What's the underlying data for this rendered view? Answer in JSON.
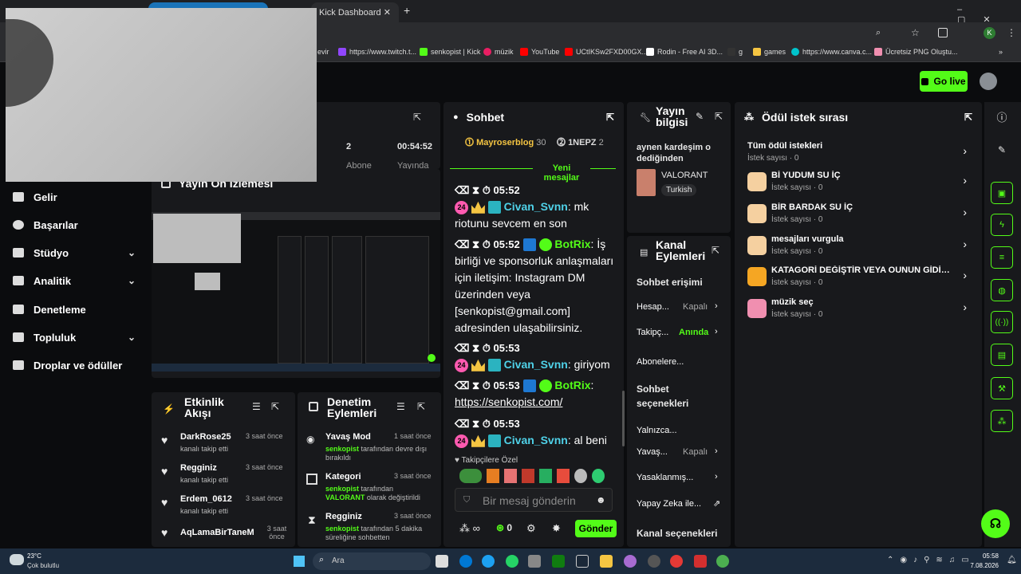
{
  "browser": {
    "tab_title": "Kick Dashboard",
    "new_tab": "+",
    "bookmarks": [
      "evir",
      "https://www.twitch.t...",
      "senkopist | Kick",
      "müzik",
      "YouTube",
      "UCtIKSw2FXD00GX...",
      "Rodin - Free AI 3D...",
      "g",
      "games",
      "https://www.canva.c...",
      "Ücretsiz PNG Oluştu..."
    ],
    "profile_initial": "K"
  },
  "header": {
    "go_live": "Go live"
  },
  "stats": {
    "subs_value": "2",
    "subs_label": "Abone",
    "time_value": "00:54:52",
    "time_label": "Yayında"
  },
  "sidebar": {
    "items": [
      {
        "label": "Gelir"
      },
      {
        "label": "Başarılar"
      },
      {
        "label": "Stüdyo",
        "chev": "⌄"
      },
      {
        "label": "Analitik",
        "chev": "⌄"
      },
      {
        "label": "Denetleme"
      },
      {
        "label": "Topluluk",
        "chev": "⌄"
      },
      {
        "label": "Droplar ve ödüller"
      }
    ]
  },
  "preview": {
    "title": "Yayın Ön İzlemesi"
  },
  "activity": {
    "title": "Etkinlik Akışı",
    "items": [
      {
        "user": "DarkRose25",
        "action": "kanalı takip etti",
        "time": "3 saat önce"
      },
      {
        "user": "Regginiz",
        "action": "kanalı takip etti",
        "time": "3 saat önce"
      },
      {
        "user": "Erdem_0612",
        "action": "kanalı takip etti",
        "time": "3 saat önce"
      },
      {
        "user": "AqLamaBirTaneM",
        "action": "",
        "time": "3 saat önce"
      }
    ]
  },
  "modactions": {
    "title": "Denetim Eylemleri",
    "items": [
      {
        "title": "Yavaş Mod",
        "time": "1 saat önce",
        "actor": "senkopist",
        "rest": "tarafından devre dışı bırakıldı"
      },
      {
        "title": "Kategori",
        "time": "3 saat önce",
        "actor": "senkopist",
        "rest": "tarafından",
        "extra": "VALORANT",
        "extra_rest": "olarak değiştirildi"
      },
      {
        "title": "Regginiz",
        "time": "3 saat önce",
        "actor": "senkopist",
        "rest": "tarafından 5 dakika süreliğine sohbetten"
      }
    ]
  },
  "chat": {
    "title": "Sohbet",
    "top": [
      {
        "rank": "1",
        "name": "Mayroserblog",
        "count": "30"
      },
      {
        "rank": "2",
        "name": "1NEPZ",
        "count": "2"
      }
    ],
    "new_messages": "Yeni mesajlar",
    "messages": [
      {
        "time": "05:52",
        "user": "Civan_Svnn",
        "text": "mk riotunu sevcem en son"
      },
      {
        "time": "05:52",
        "user": "BotRix",
        "text": "İş birliği ve sponsorluk anlaşmaları için iletişim: Instagram DM üzerinden veya [senkopist@gmail.com] adresinden ulaşabilirsiniz."
      },
      {
        "time": "05:53",
        "user": "Civan_Svnn",
        "text": "giriyom"
      },
      {
        "time": "05:53",
        "user": "BotRix",
        "text": "https://senkopist.com/"
      },
      {
        "time": "05:53",
        "user": "Civan_Svnn",
        "text": "al beni"
      }
    ],
    "followers_only": "Takipçilere Özel",
    "placeholder": "Bir mesaj gönderin",
    "send": "Gönder",
    "points": "0",
    "badge_24": "24"
  },
  "streaminfo": {
    "title": "Yayın bilgisi",
    "stream_title": "aynen kardeşim o dediğinden",
    "game": "VALORANT",
    "language": "Turkish"
  },
  "channel": {
    "title": "Kanal Eylemleri",
    "chat_access": "Sohbet erişimi",
    "rows": [
      {
        "label": "Hesap...",
        "value": "Kapalı"
      },
      {
        "label": "Takipç...",
        "value": "Anında"
      },
      {
        "label": "Abonelere..."
      }
    ],
    "chat_options": "Sohbet seçenekleri",
    "rows2": [
      {
        "label": "Yalnızca..."
      },
      {
        "label": "Yavaş...",
        "value": "Kapalı"
      },
      {
        "label": "Yasaklanmış..."
      },
      {
        "label": "Yapay Zeka ile..."
      }
    ],
    "channel_options": "Kanal seçenekleri"
  },
  "rewards": {
    "title": "Ödül istek sırası",
    "all": "Tüm ödül istekleri",
    "all_count": "İstek sayısı · 0",
    "items": [
      {
        "title": "Bİ YUDUM SU İÇ",
        "count": "İstek sayısı · 0",
        "color": "#f5d0a0"
      },
      {
        "title": "BİR BARDAK SU İÇ",
        "count": "İstek sayısı · 0",
        "color": "#f5d0a0"
      },
      {
        "title": "mesajları vurgula",
        "count": "İstek sayısı · 0",
        "color": "#f5d0a0"
      },
      {
        "title": "KATAGORİ DEĞİŞTİR VEYA OUNUN GİDİŞAT...",
        "count": "İstek sayısı · 0",
        "color": "#f5a623"
      },
      {
        "title": "müzik seç",
        "count": "İstek sayısı · 0",
        "color": "#f08fb0"
      }
    ]
  },
  "taskbar": {
    "weather_temp": "23°C",
    "weather_text": "Çok bulutlu",
    "search": "Ara",
    "time": "05:58",
    "date": "7.08.2026"
  },
  "colors": {
    "accent": "#53fc18",
    "panel": "#18191c",
    "bg": "#0b0c0e"
  }
}
